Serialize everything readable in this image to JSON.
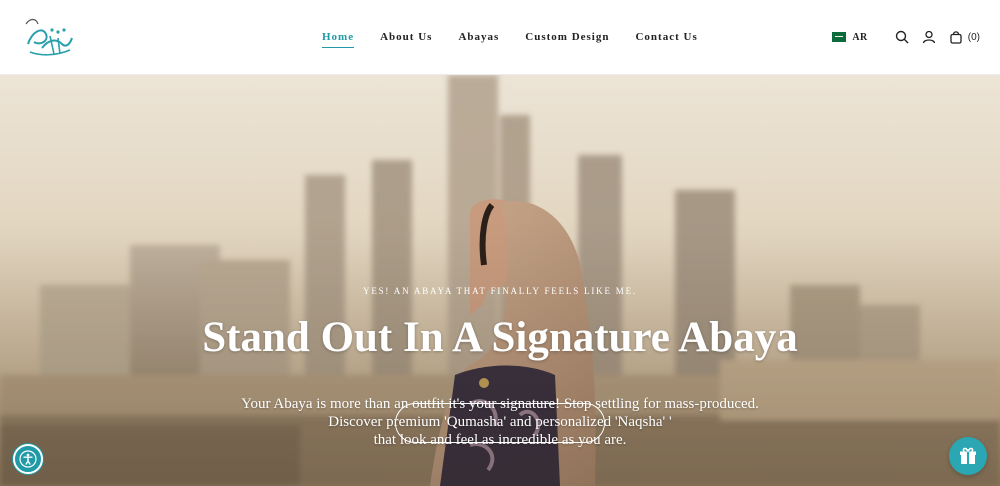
{
  "header": {
    "logo_name": "calligraphy-logo",
    "nav": [
      {
        "label": "Home",
        "active": true
      },
      {
        "label": "About Us",
        "active": false
      },
      {
        "label": "Abayas",
        "active": false
      },
      {
        "label": "Custom Design",
        "active": false
      },
      {
        "label": "Contact Us",
        "active": false
      }
    ],
    "language": "AR",
    "cart_count": "(0)"
  },
  "hero": {
    "eyebrow": "YES! AN ABAYA THAT FINALLY FEELS LIKE ME.",
    "headline": "Stand Out In A Signature Abaya",
    "body_line1": "Your Abaya is more than an outfit it's your signature! Stop settling for mass-produced.",
    "body_line2": "Discover premium 'Qumasha' and personalized 'Naqsha' '",
    "body_line3": "that look and feel as incredible as you are."
  },
  "colors": {
    "accent": "#1f9aa6",
    "text": "#222222",
    "hero_text": "#ffffff"
  },
  "icons": [
    "saudi-flag-icon",
    "search-icon",
    "user-icon",
    "cart-icon",
    "accessibility-icon",
    "gift-icon"
  ]
}
